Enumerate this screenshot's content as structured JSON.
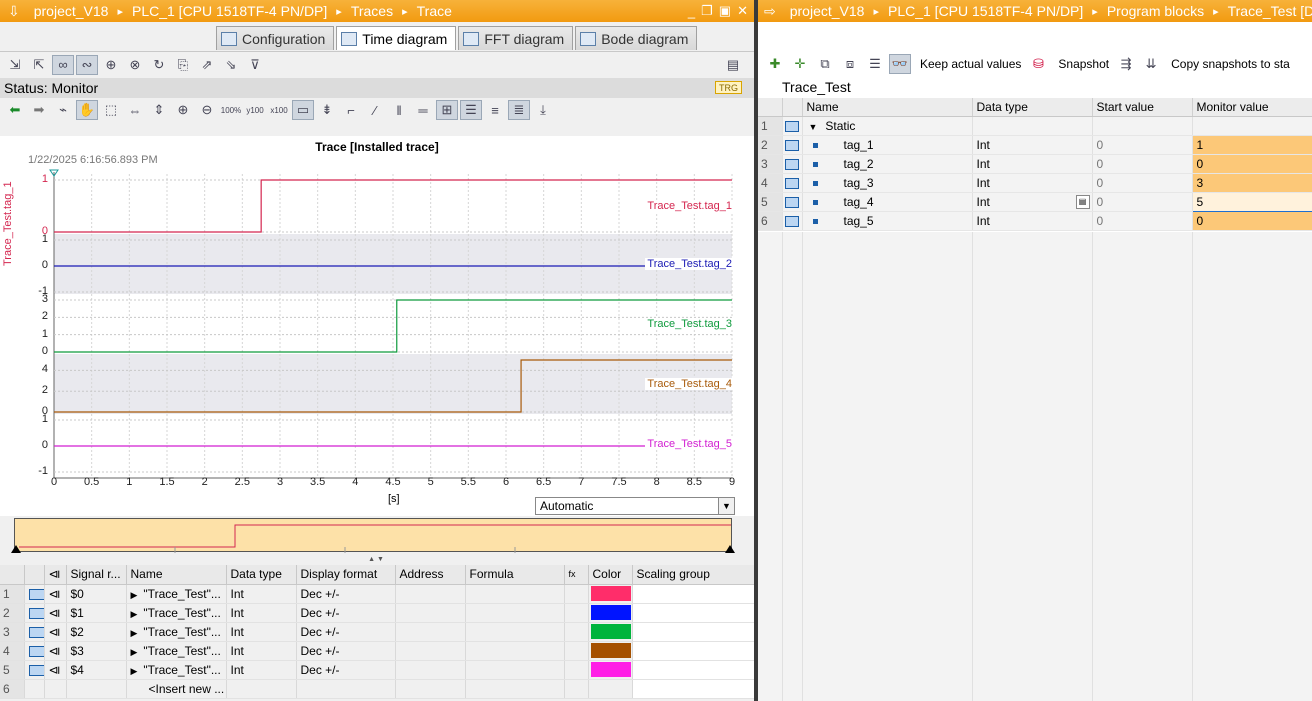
{
  "left_title": {
    "crumbs": [
      "project_V18",
      "PLC_1 [CPU 1518TF-4 PN/DP]",
      "Traces",
      "Trace"
    ]
  },
  "right_title": {
    "crumbs": [
      "project_V18",
      "PLC_1 [CPU 1518TF-4 PN/DP]",
      "Program blocks",
      "Trace_Test [D"
    ]
  },
  "tabs": [
    {
      "label": "Configuration",
      "active": false
    },
    {
      "label": "Time diagram",
      "active": true
    },
    {
      "label": "FFT diagram",
      "active": false
    },
    {
      "label": "Bode diagram",
      "active": false
    }
  ],
  "status": {
    "label": "Status: Monitor",
    "badge": "TRG"
  },
  "chart_data": {
    "type": "line",
    "title": "Trace [Installed trace]",
    "timestamp": "1/22/2025  6:16:56.893 PM",
    "xlabel": "[s]",
    "xlim": [
      0,
      9
    ],
    "x_ticks": [
      "0",
      "0.5",
      "1",
      "1.5",
      "2",
      "2.5",
      "3",
      "3.5",
      "4",
      "4.5",
      "5",
      "5.5",
      "6",
      "6.5",
      "7",
      "7.5",
      "8",
      "8.5",
      "9"
    ],
    "y_axis_label": "Trace_Test.tag_1",
    "series": [
      {
        "name": "Trace_Test.tag_1",
        "color": "#d4264f",
        "ylim": [
          0,
          1
        ],
        "y_ticks": [
          "1",
          "0"
        ],
        "x": [
          0,
          2.75,
          2.75,
          9
        ],
        "y": [
          0,
          0,
          1,
          1
        ]
      },
      {
        "name": "Trace_Test.tag_2",
        "color": "#1a1ab4",
        "ylim": [
          -1,
          1
        ],
        "y_ticks": [
          "1",
          "0",
          "-1"
        ],
        "x": [
          0,
          9
        ],
        "y": [
          0,
          0
        ]
      },
      {
        "name": "Trace_Test.tag_3",
        "color": "#0e9a3c",
        "ylim": [
          0,
          3
        ],
        "y_ticks": [
          "3",
          "2",
          "1",
          "0"
        ],
        "x": [
          0,
          4.55,
          4.55,
          9
        ],
        "y": [
          0,
          0,
          3,
          3
        ]
      },
      {
        "name": "Trace_Test.tag_4",
        "color": "#a85a0a",
        "ylim": [
          0,
          5
        ],
        "y_ticks": [
          "4",
          "2",
          "0"
        ],
        "x": [
          0,
          6.2,
          6.2,
          9
        ],
        "y": [
          0,
          0,
          5,
          5
        ]
      },
      {
        "name": "Trace_Test.tag_5",
        "color": "#d21fd2",
        "ylim": [
          -1,
          1
        ],
        "y_ticks": [
          "1",
          "0",
          "-1"
        ],
        "x": [
          0,
          9
        ],
        "y": [
          0,
          0
        ]
      }
    ],
    "grid": true
  },
  "x_mode_select": "Automatic",
  "signal_table": {
    "headers": [
      "Signal r...",
      "Name",
      "Data type",
      "Display format",
      "Address",
      "Formula",
      "Color",
      "Scaling group"
    ],
    "rows": [
      {
        "num": "1",
        "signal": "$0",
        "name": "\"Trace_Test\"...",
        "type": "Int",
        "format": "Dec +/-",
        "color": "#ff2d6a"
      },
      {
        "num": "2",
        "signal": "$1",
        "name": "\"Trace_Test\"...",
        "type": "Int",
        "format": "Dec +/-",
        "color": "#0014ff"
      },
      {
        "num": "3",
        "signal": "$2",
        "name": "\"Trace_Test\"...",
        "type": "Int",
        "format": "Dec +/-",
        "color": "#00b43c"
      },
      {
        "num": "4",
        "signal": "$3",
        "name": "\"Trace_Test\"...",
        "type": "Int",
        "format": "Dec +/-",
        "color": "#a55000"
      },
      {
        "num": "5",
        "signal": "$4",
        "name": "\"Trace_Test\"...",
        "type": "Int",
        "format": "Dec +/-",
        "color": "#ff1ee6"
      }
    ],
    "insert_row": {
      "num": "6",
      "label": "<Insert new ..."
    }
  },
  "right_toolbar": {
    "keep_actual": "Keep actual values",
    "snapshot": "Snapshot",
    "copy": "Copy snapshots to sta"
  },
  "db": {
    "title": "Trace_Test",
    "headers": [
      "Name",
      "Data type",
      "Start value",
      "Monitor value"
    ],
    "rows": [
      {
        "num": "1",
        "name": "Static",
        "type": "",
        "start": "",
        "monitor": "",
        "group": true
      },
      {
        "num": "2",
        "name": "tag_1",
        "type": "Int",
        "start": "0",
        "monitor": "1"
      },
      {
        "num": "3",
        "name": "tag_2",
        "type": "Int",
        "start": "0",
        "monitor": "0"
      },
      {
        "num": "4",
        "name": "tag_3",
        "type": "Int",
        "start": "0",
        "monitor": "3"
      },
      {
        "num": "5",
        "name": "tag_4",
        "type": "Int",
        "start": "0",
        "monitor": "5"
      },
      {
        "num": "6",
        "name": "tag_5",
        "type": "Int",
        "start": "0",
        "monitor": "0"
      }
    ]
  }
}
